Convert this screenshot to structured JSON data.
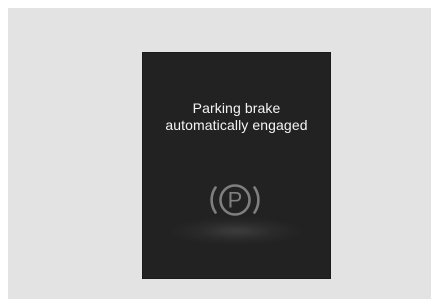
{
  "alert": {
    "message_line1": "Parking brake",
    "message_line2": "automatically engaged",
    "icon": "parking-brake-icon",
    "icon_letter": "P"
  },
  "colors": {
    "page_background": "#e3e3e3",
    "display_background": "#222222",
    "text": "#f4f4f4",
    "icon": "#7f7f7f"
  }
}
